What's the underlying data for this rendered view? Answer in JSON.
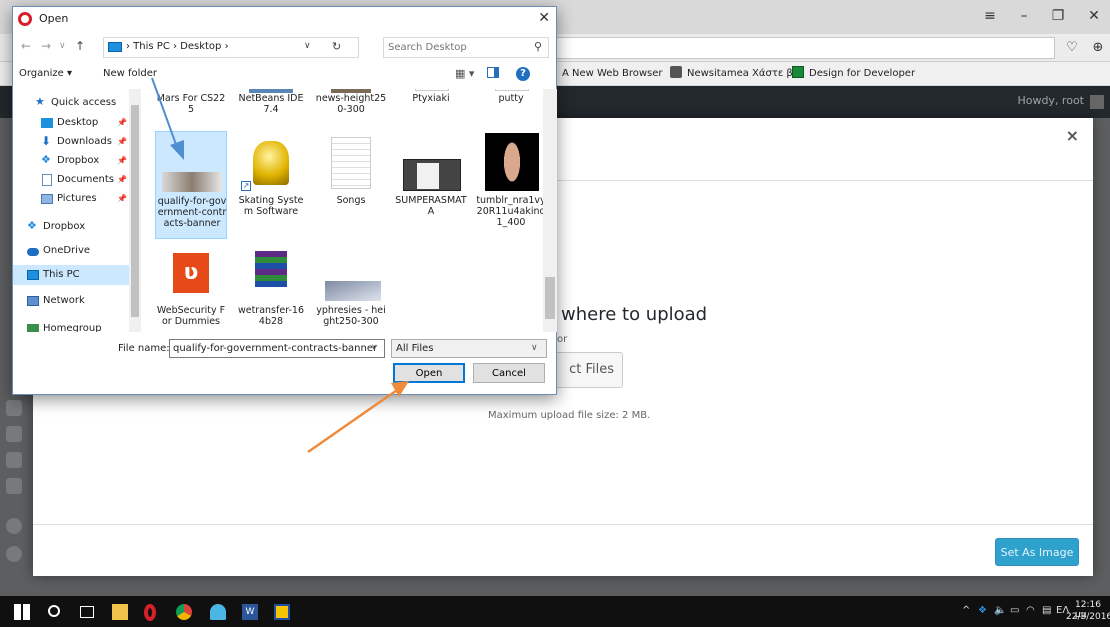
{
  "browser": {
    "bookmarks": [
      "A New Web Browser",
      "Newsitamea Χάστε β",
      "Design for Developer"
    ],
    "win_controls": [
      "≡",
      "–",
      "❐",
      "✕"
    ]
  },
  "wp": {
    "howdy": "Howdy, root",
    "modal": {
      "upload_title": "where to upload",
      "or": "or",
      "select_files": "ct Files",
      "max_upload": "Maximum upload file size: 2 MB.",
      "set_as_image": "Set As Image",
      "close": "×"
    }
  },
  "dialog": {
    "title": "Open",
    "path": "›  This PC  ›  Desktop  ›",
    "search_placeholder": "Search Desktop",
    "organize": "Organize ▾",
    "new_folder": "New folder",
    "nav": [
      {
        "label": "Quick access",
        "icon": "star-icon"
      },
      {
        "label": "Desktop",
        "icon": "desktop-icon"
      },
      {
        "label": "Downloads",
        "icon": "download-icon"
      },
      {
        "label": "Dropbox",
        "icon": "dropbox-icon"
      },
      {
        "label": "Documents",
        "icon": "documents-icon"
      },
      {
        "label": "Pictures",
        "icon": "pictures-icon"
      },
      {
        "label": "Dropbox",
        "icon": "dropbox-icon"
      },
      {
        "label": "OneDrive",
        "icon": "onedrive-icon"
      },
      {
        "label": "This PC",
        "icon": "pc-icon"
      },
      {
        "label": "Network",
        "icon": "network-icon"
      },
      {
        "label": "Homegroup",
        "icon": "homegroup-icon"
      }
    ],
    "files_row1": [
      "Mars For CS225",
      "NetBeans IDE 7.4",
      "news-height250-300",
      "Ptyxiaki",
      "putty"
    ],
    "files_row2": [
      "qualify-for-government-contracts-banner",
      "Skating System Software",
      "Songs",
      "SUMPERASMATA",
      "tumblr_nra1vy20R11u4akino1_400"
    ],
    "files_row3": [
      "WebSecurity For Dummies",
      "wetransfer-164b28",
      "yphresies - height250-300"
    ],
    "file_name_label": "File name:",
    "file_name_value": "qualify-for-government-contracts-banner",
    "file_type": "All Files",
    "open": "Open",
    "cancel": "Cancel"
  },
  "taskbar": {
    "lang": "ΕΛ",
    "time": "12:16 μμ",
    "date": "22/3/2016"
  },
  "colors": {
    "accent": "#0078d7",
    "arrow_blue": "#4f8ed0",
    "arrow_orange": "#ef8a3a",
    "wp_button": "#2ea2cc"
  }
}
